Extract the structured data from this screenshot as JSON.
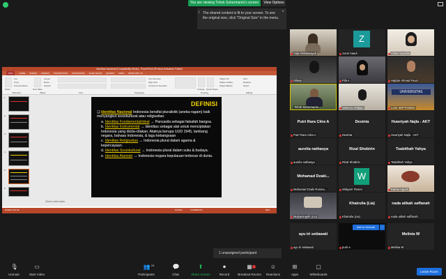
{
  "banner": {
    "sharing_text": "You are viewing Tohok Suhermanto's screen",
    "view_options": "View Options"
  },
  "tooltip": {
    "text": "The shared content is fit to your screen. To see the original size, click \"Original Size\" in the menu.",
    "close": "×",
    "icon": "i"
  },
  "ppt": {
    "title": "Identitas Nasional [Compatibility Mode] - PowerPoint (Product Activation Failed)",
    "tabs": [
      "FILE",
      "HOME",
      "INSERT",
      "DESIGN",
      "TRANSITIONS",
      "ANIMATIONS",
      "SLIDE SHOW",
      "REVIEW",
      "VIEW",
      "NITRO PRO 10"
    ],
    "ribbon": {
      "paste": "Paste",
      "cut": "Cut",
      "copy": "Copy",
      "format_painter": "Format Painter",
      "clipboard": "Clipboard",
      "new_slide": "New Slide",
      "layout": "Layout",
      "reset": "Reset",
      "section": "Section",
      "slides": "Slides",
      "font": "Font",
      "paragraph": "Paragraph",
      "text_direction": "Text Direction",
      "align_text": "Align Text",
      "convert_smartart": "Convert to SmartArt",
      "arrange": "Arrange",
      "quick_styles": "Quick Styles",
      "shape_fill": "Shape Fill",
      "shape_outline": "Shape Outline",
      "shape_effects": "Shape Effects",
      "drawing": "Drawing",
      "find": "Find",
      "replace": "Replace",
      "select": "Select",
      "editing": "Editing"
    },
    "thumb_numbers": [
      "1",
      "2",
      "3",
      "4",
      "5",
      "6"
    ],
    "notes_placeholder": "Click to add notes",
    "status_left": "SLIDE 5 OF 20",
    "status_notes": "NOTES",
    "status_comments": "COMMENTS",
    "status_zoom": "85%"
  },
  "slide": {
    "title": "DEFINISI",
    "intro_heading": "Identitas Nasional",
    "intro_rest": " Indonesia bersifat pluralistik (aneka-ragam) baik menyangkut sosiokultural atau religiusitas:",
    "items": [
      {
        "letter": "a.",
        "term": "Identitas Fundamental/ideal",
        "desc": " → Pancasila sebagai falsafah bangsa."
      },
      {
        "letter": "b.",
        "term": "Identitas Instrumental",
        "desc": " → identitas sebagai alat untuk menciptakan Indonesia yang dicita-citakan. Alatnya berupa UUD 1945, lambang negara, bahasa Indonesia, & lagu kebangsaan"
      },
      {
        "letter": "c.",
        "term": "Identitas Religiusitas",
        "desc": " → Indonesia plural dalam agama & kepercayaan."
      },
      {
        "letter": "d.",
        "term": "Identitas Sosiokultural",
        "desc": " → Indonesia plural dalam suku & budaya."
      },
      {
        "letter": "e.",
        "term": "Identitas Alamiah",
        "desc": " → Indonesia negara kepulauan terbesar di dunia."
      }
    ]
  },
  "participants": [
    {
      "label": "Anja Herdiansyah",
      "big": "",
      "kind": "video"
    },
    {
      "label": "zoom baadi",
      "big": "",
      "kind": "z"
    },
    {
      "label": "Azhar Syadida",
      "big": "",
      "kind": "video"
    },
    {
      "label": "Dilasyi",
      "big": "",
      "kind": "video"
    },
    {
      "label": "Fifa A",
      "big": "",
      "kind": "video"
    },
    {
      "label": "Hajidar Ahmad Fauzi",
      "big": "",
      "kind": "video"
    },
    {
      "label": "Tohok Suhermanto",
      "big": "",
      "kind": "video"
    },
    {
      "label": "Valencia Widjaja",
      "big": "",
      "kind": "video"
    },
    {
      "label": "LUSI SEPTIANDO",
      "big": "",
      "kind": "video"
    },
    {
      "label": "Putri Rara Citra A",
      "big": "Putri Rara Citra A",
      "kind": "name"
    },
    {
      "label": "Desinta",
      "big": "Desinta",
      "kind": "name"
    },
    {
      "label": "Huwriyah Najla - AKT",
      "big": "Huwriyah Najla - AKT",
      "kind": "name"
    },
    {
      "label": "aurelia nathasya",
      "big": "aurelia nathasya",
      "kind": "name"
    },
    {
      "label": "Rizal Shobirin",
      "big": "Rizal Shobirin",
      "kind": "name"
    },
    {
      "label": "Tsabithah Yahya",
      "big": "Tsabithah Yahya",
      "kind": "name"
    },
    {
      "label": "Mohamad Dzaki Rosma...",
      "big": "Mohamad Dzaki...",
      "kind": "name"
    },
    {
      "label": "Widyarrr Rosmi",
      "big": "",
      "kind": "w"
    },
    {
      "label": "Karina Agusti",
      "big": "",
      "kind": "video"
    },
    {
      "label": "Mulyaningsih (Lia)",
      "big": "",
      "kind": "video"
    },
    {
      "label": "Khairulia (Lia)",
      "big": "Khairulia (Lia)",
      "kind": "name"
    },
    {
      "label": "nada atikah saffanah",
      "big": "nada atikah saffanah",
      "kind": "name"
    },
    {
      "label": "ayu tri setiawati",
      "big": "ayu tri setiawati",
      "kind": "name"
    },
    {
      "label": "putri a",
      "big": "",
      "kind": "dark"
    },
    {
      "label": "Melinia W",
      "big": "Melinia W",
      "kind": "name"
    }
  ],
  "ask_to_unmute": "Ask to Unmute",
  "ask_more": "···",
  "unassigned": "1 unassigned participant",
  "toolbar": {
    "unmute": "Unmute",
    "start_video": "Start Video",
    "participants": "Participants",
    "participants_count": "24",
    "chat": "Chat",
    "share_screen": "Share Screen",
    "record": "Record",
    "breakout_rooms": "Breakout Rooms",
    "reactions": "Reactions",
    "apps": "Apps",
    "whiteboards": "Whiteboards",
    "leave": "Leave Room"
  },
  "colors": {
    "accent": "#1e6fdc",
    "share_green": "#1a9d55",
    "ppt_red": "#b7472a",
    "slide_yellow": "#f0d000"
  }
}
